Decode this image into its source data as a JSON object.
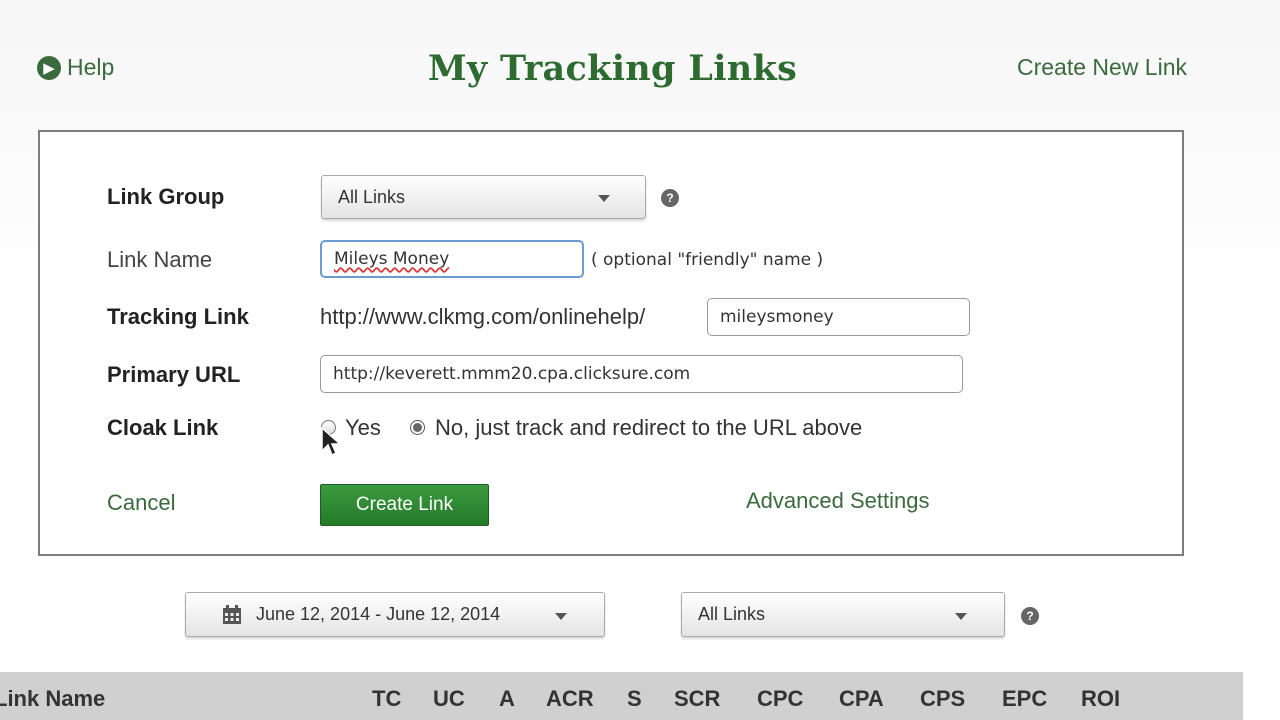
{
  "header": {
    "help_label": "Help",
    "title": "My Tracking Links",
    "create_new_label": "Create New Link"
  },
  "form": {
    "link_group": {
      "label": "Link Group",
      "value": "All Links",
      "help": "?"
    },
    "link_name": {
      "label": "Link Name",
      "value": "Mileys Money",
      "hint": "( optional \"friendly\" name )"
    },
    "tracking_link": {
      "label": "Tracking Link",
      "prefix": "http://www.clkmg.com/onlinehelp/",
      "value": "mileysmoney"
    },
    "primary_url": {
      "label": "Primary URL",
      "value": "http://keverett.mmm20.cpa.clicksure.com"
    },
    "cloak_link": {
      "label": "Cloak Link",
      "options": [
        "Yes",
        "No, just track and redirect to the URL above"
      ],
      "selected": "No, just track and redirect to the URL above"
    },
    "cancel_label": "Cancel",
    "create_label": "Create Link",
    "advanced_label": "Advanced Settings"
  },
  "filters": {
    "date_range": "June 12, 2014 - June 12, 2014",
    "group": "All Links",
    "help": "?"
  },
  "table": {
    "columns": [
      "Link Name",
      "TC",
      "UC",
      "A",
      "ACR",
      "S",
      "SCR",
      "CPC",
      "CPA",
      "CPS",
      "EPC",
      "ROI"
    ]
  },
  "colors": {
    "accent_green": "#3b6b3d",
    "button_green": "#2e8b33",
    "table_header_bg": "#d0d0d0"
  }
}
